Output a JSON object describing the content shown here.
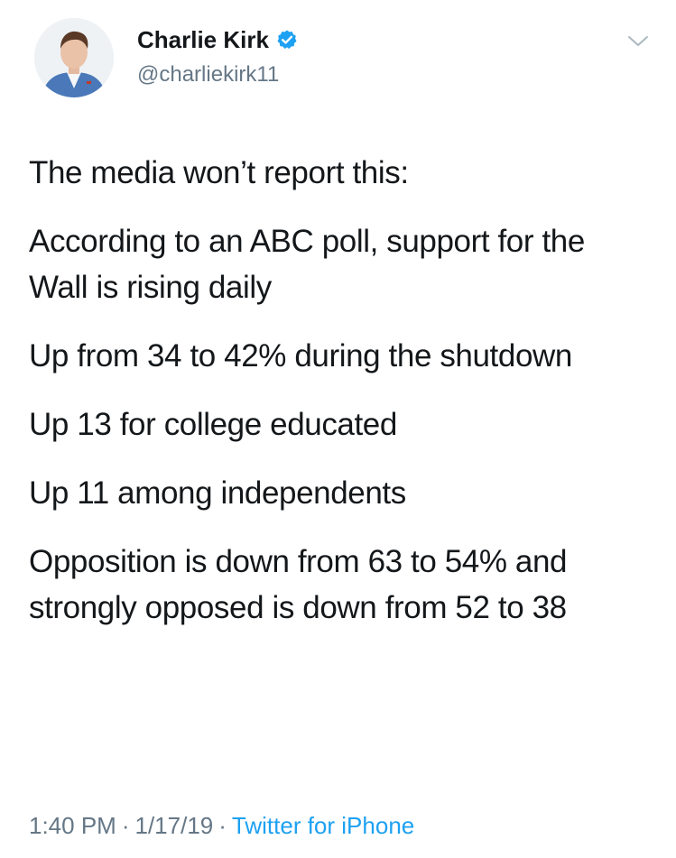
{
  "tweet": {
    "author": {
      "display_name": "Charlie Kirk",
      "handle": "@charliekirk11",
      "verified": true,
      "avatar_icon": "profile-photo"
    },
    "menu_icon": "chevron-down-icon",
    "paragraphs": [
      "The media won’t report this:",
      "According to an ABC poll, support for the Wall is rising daily",
      "Up from 34 to 42% during the shutdown",
      "Up 13 for college educated",
      "Up 11 among independents",
      "Opposition is down from 63 to 54% and strongly opposed is down from 52 to 38"
    ],
    "meta": {
      "time": "1:40 PM",
      "separator": "·",
      "date": "1/17/19",
      "source": "Twitter for iPhone"
    }
  },
  "colors": {
    "text_primary": "#14171a",
    "text_secondary": "#657786",
    "accent": "#1da1f2"
  }
}
